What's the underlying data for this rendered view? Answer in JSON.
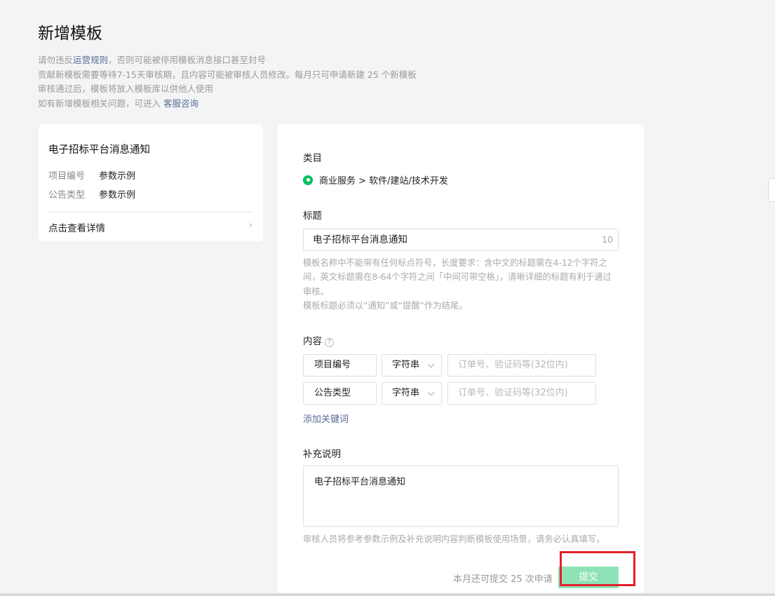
{
  "page": {
    "title": "新增模板"
  },
  "notice": {
    "line1_prefix": "请勿违反",
    "line1_link": "运营规则",
    "line1_suffix": "，否则可能被停用模板消息接口甚至封号",
    "line2": "贡献新模板需要等待7-15天审核期，且内容可能被审核人员修改。每月只可申请新建 25 个新模板",
    "line3": "审核通过后，模板将放入模板库以供他人使用",
    "line4_prefix": "如有新增模板相关问题，可进入 ",
    "line4_link": "客服咨询"
  },
  "preview": {
    "title": "电子招标平台消息通知",
    "rows": [
      {
        "key": "项目编号",
        "value": "参数示例"
      },
      {
        "key": "公告类型",
        "value": "参数示例"
      }
    ],
    "detail_link": "点击查看详情",
    "chevron_icon": "chevron-right-icon"
  },
  "form": {
    "category_label": "类目",
    "category_value": "商业服务 > 软件/建站/技术开发",
    "title_label": "标题",
    "title_value": "电子招标平台消息通知",
    "title_count": "10",
    "title_hint1": "模板名称中不能带有任何标点符号，长度要求：含中文的标题需在4-12个字符之间，英文标题需在8-64个字符之间「中间可带空格」，清晰详细的标题有利于通过审核。",
    "title_hint2": "模板标题必须以“通知”或“提醒”作为结尾。",
    "content_label": "内容",
    "help_icon": "?",
    "keywords": [
      {
        "name": "项目编号",
        "type": "字符串",
        "example_placeholder": "订单号、验证码等(32位内)"
      },
      {
        "name": "公告类型",
        "type": "字符串",
        "example_placeholder": "订单号、验证码等(32位内)"
      }
    ],
    "add_keyword": "添加关键词",
    "supplement_label": "补充说明",
    "supplement_value": "电子招标平台消息通知",
    "supplement_hint": "审核人员将参考参数示例及补充说明内容判断模板使用场景，请务必认真填写。",
    "quota_text": "本月还可提交 25 次申请",
    "submit_label": "提交"
  },
  "colors": {
    "accent_green": "#07c160",
    "submit_disabled": "#8ee3b6",
    "link_blue": "#576b95",
    "highlight_red": "#e3202a"
  }
}
